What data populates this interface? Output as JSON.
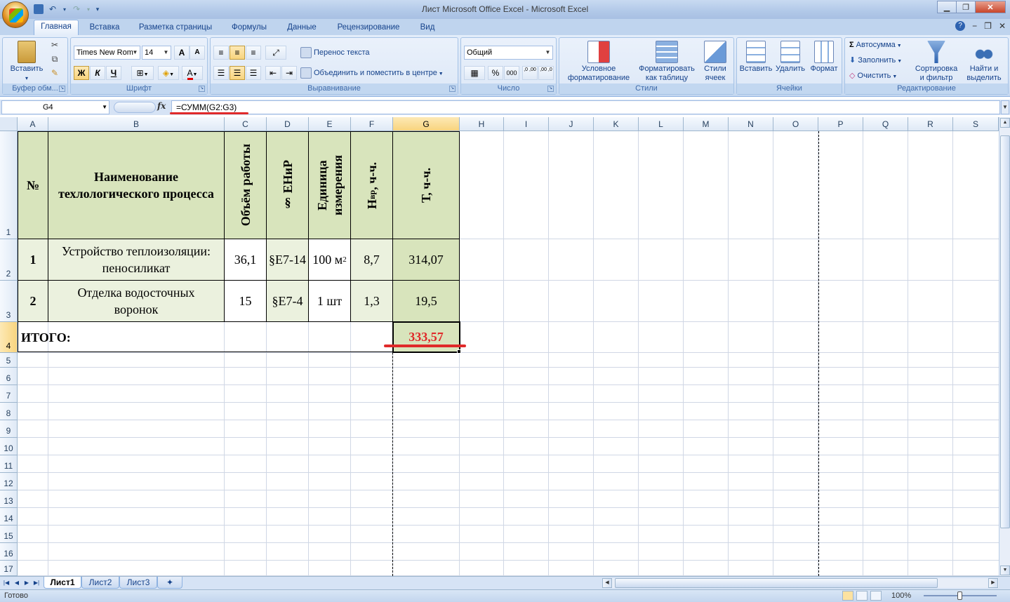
{
  "window": {
    "title": "Лист Microsoft Office Excel - Microsoft Excel"
  },
  "qat": {
    "save_icon": "save-icon",
    "undo_icon": "undo-icon",
    "redo_icon": "redo-icon",
    "customize": "▾"
  },
  "tabs": [
    "Главная",
    "Вставка",
    "Разметка страницы",
    "Формулы",
    "Данные",
    "Рецензирование",
    "Вид"
  ],
  "ribbon": {
    "clipboard": {
      "label": "Буфер обм...",
      "paste": "Вставить"
    },
    "font": {
      "label": "Шрифт",
      "name": "Times New Rom",
      "size": "14",
      "bold": "Ж",
      "italic": "К",
      "underline": "Ч",
      "grow": "A",
      "shrink": "A",
      "font_color": "A"
    },
    "alignment": {
      "label": "Выравнивание",
      "wrap": "Перенос текста",
      "merge": "Объединить и поместить в центре"
    },
    "number": {
      "label": "Число",
      "format": "Общий",
      "percent": "%",
      "thousands": "000",
      "inc_dec": ",0 ,00",
      "dec_dec": ",00 ,0"
    },
    "styles": {
      "label": "Стили",
      "conditional": "Условное форматирование",
      "table": "Форматировать как таблицу",
      "cell_styles": "Стили ячеек"
    },
    "cells": {
      "label": "Ячейки",
      "insert": "Вставить",
      "delete": "Удалить",
      "format": "Формат"
    },
    "editing": {
      "label": "Редактирование",
      "autosum": "Автосумма",
      "fill": "Заполнить",
      "clear": "Очистить",
      "sort": "Сортировка и фильтр",
      "find": "Найти и выделить"
    }
  },
  "formula_bar": {
    "name_box": "G4",
    "fx": "fx",
    "formula": "=СУММ(G2:G3)"
  },
  "columns": [
    "A",
    "B",
    "C",
    "D",
    "E",
    "F",
    "G",
    "H",
    "I",
    "J",
    "K",
    "L",
    "M",
    "N",
    "O",
    "P",
    "Q",
    "R",
    "S"
  ],
  "rows": [
    "1",
    "2",
    "3",
    "4",
    "5",
    "6",
    "7",
    "8",
    "9",
    "10",
    "11",
    "12",
    "13",
    "14",
    "15",
    "16",
    "17"
  ],
  "table": {
    "header": {
      "num": "№",
      "name": "Наименование техлологического процесса",
      "volume": "Объём работы",
      "enir": "§ ЕНиР",
      "unit": "Единица измерения",
      "norm": "Нвр, ч-ч.",
      "norm_main": "Н",
      "norm_sub": "вр",
      "norm_rest": ", ч-ч.",
      "time": "Т, ч-ч."
    },
    "rows": [
      {
        "num": "1",
        "name": "Устройство теплоизоляции: пеносиликат",
        "volume": "36,1",
        "enir": "§Е7-14",
        "unit": "100 м",
        "unit_sup": "2",
        "norm": "8,7",
        "time": "314,07"
      },
      {
        "num": "2",
        "name": "Отделка водосточных воронок",
        "volume": "15",
        "enir": "§Е7-4",
        "unit": "1 шт",
        "norm": "1,3",
        "time": "19,5"
      }
    ],
    "total": {
      "label": "ИТОГО:",
      "value": "333,57",
      "value_color": "#e02a2a"
    }
  },
  "sheets": [
    "Лист1",
    "Лист2",
    "Лист3"
  ],
  "status": {
    "ready": "Готово",
    "zoom": "100%"
  },
  "colors": {
    "header_green": "#d8e4bc",
    "cell_green": "#ebf1de",
    "selection_orange": "#f8d47e",
    "annotation_red": "#e02a2a"
  }
}
